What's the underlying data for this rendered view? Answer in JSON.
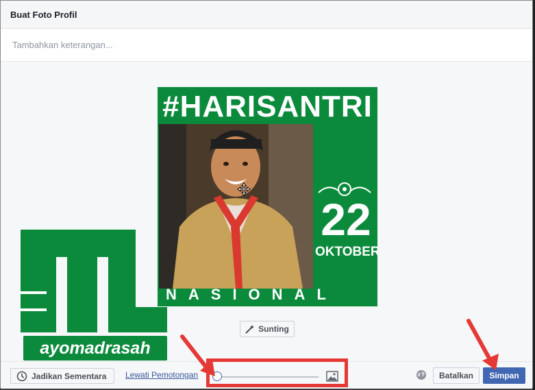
{
  "dialog": {
    "title": "Buat Foto Profil",
    "caption_placeholder": "Tambahkan keterangan..."
  },
  "photo": {
    "headline": "#HARISANTRI",
    "day": "22",
    "month": "OKTOBER",
    "banner": "NASIONAL"
  },
  "edit_button_label": "Sunting",
  "footer": {
    "temporary_label": "Jadikan Sementara",
    "skip_crop_label": "Lewati Pemotongan",
    "zoom_level": 0,
    "cancel_label": "Batalkan",
    "save_label": "Simpan"
  },
  "watermark": {
    "text": "ayomadrasah"
  },
  "colors": {
    "brand_green": "#0c8a3c",
    "primary_button": "#4267b2",
    "link": "#365899",
    "annotation_red": "#e53935"
  },
  "icons": [
    "move-cursor-icon",
    "magic-wand-icon",
    "clock-icon",
    "image-icon",
    "globe-icon"
  ]
}
